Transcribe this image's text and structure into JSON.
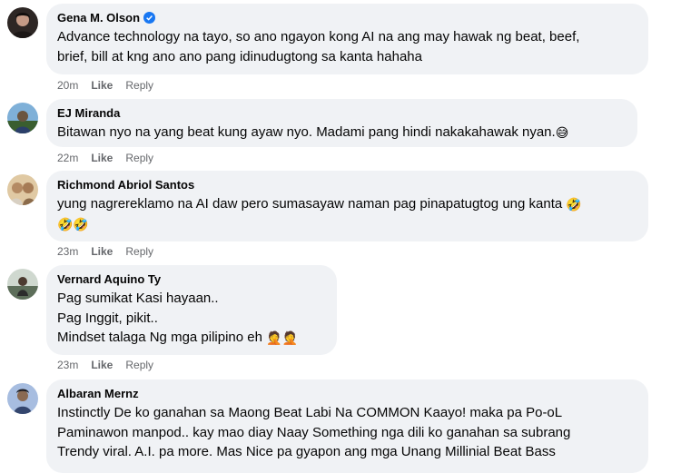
{
  "comments": [
    {
      "author": "Gena M. Olson",
      "verified": true,
      "lines": [
        "Advance technology na tayo, so ano ngayon kong AI na ang may hawak ng beat, beef,",
        "brief, bill at kng ano ano pang idinudugtong sa kanta hahaha"
      ],
      "time": "20m",
      "like": "Like",
      "reply": "Reply",
      "avatar_color": "#3b3330"
    },
    {
      "author": "EJ Miranda",
      "verified": false,
      "lines": [
        "Bitawan nyo na yang beat kung ayaw nyo. Madami pang hindi nakakahawak nyan."
      ],
      "emoji": [
        "😅"
      ],
      "time": "22m",
      "like": "Like",
      "reply": "Reply",
      "avatar_color": "#5a86b8"
    },
    {
      "author": "Richmond Abriol Santos",
      "verified": false,
      "lines": [
        "yung nagrereklamo na AI daw pero sumasayaw naman pag pinapatugtog ung kanta"
      ],
      "emoji": [
        "🤣",
        "🤣🤣"
      ],
      "time": "23m",
      "like": "Like",
      "reply": "Reply",
      "avatar_color": "#c9a57a"
    },
    {
      "author": "Vernard Aquino Ty",
      "verified": false,
      "lines": [
        "Pag sumikat Kasi hayaan..",
        "Pag Inggit, pikit..",
        "Mindset talaga Ng mga pilipino eh"
      ],
      "emoji": [
        "🤦🤦"
      ],
      "time": "23m",
      "like": "Like",
      "reply": "Reply",
      "avatar_color": "#6f7e72"
    },
    {
      "author": "Albaran Mernz",
      "verified": false,
      "lines": [
        "Instinctly De ko ganahan sa Maong Beat Labi Na COMMON Kaayo! maka pa Po-oL",
        "Paminawon manpod.. kay mao diay Naay Something nga dili ko ganahan sa subrang",
        "Trendy viral. A.I. pa more. Mas Nice pa gyapon ang mga Unang Millinial Beat Bass"
      ],
      "avatar_color": "#7a8fb0"
    }
  ]
}
